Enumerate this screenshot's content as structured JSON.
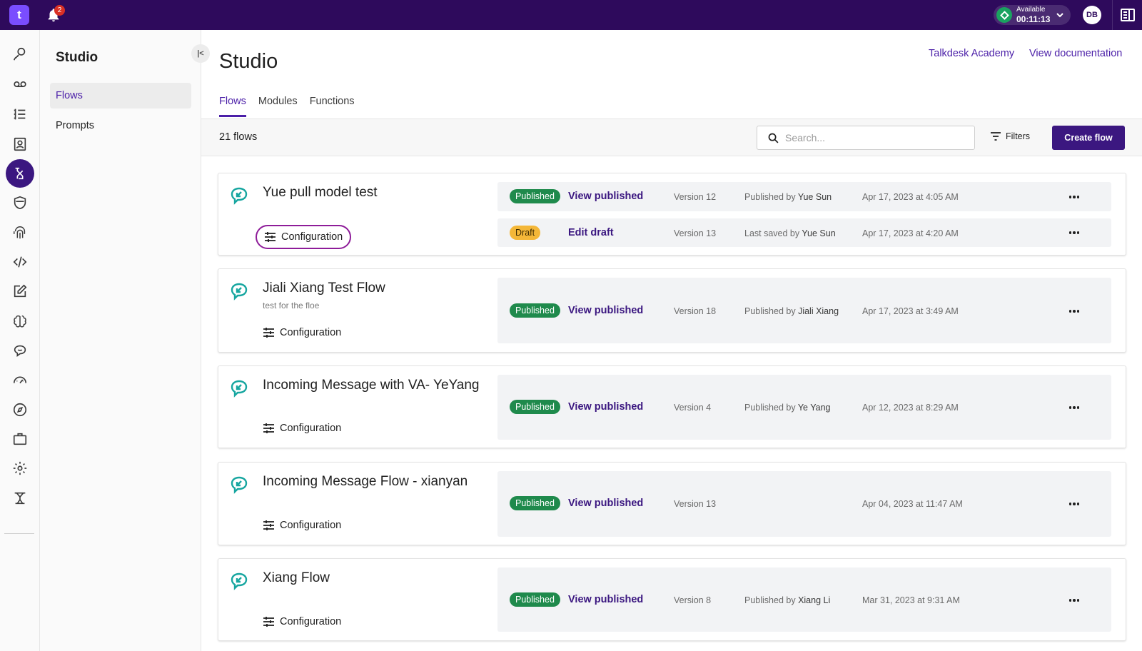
{
  "app": {
    "logo_text": "t",
    "notification_count": "2",
    "status_label": "Available",
    "status_timer": "00:11:13",
    "avatar_initials": "DB",
    "accent_color": "#2e0a5c"
  },
  "sidebar": {
    "title": "Studio",
    "items": [
      {
        "label": "Flows",
        "active": true
      },
      {
        "label": "Prompts",
        "active": false
      }
    ]
  },
  "header": {
    "title": "Studio",
    "links": [
      "Talkdesk Academy",
      "View documentation"
    ],
    "tabs": [
      "Flows",
      "Modules",
      "Functions"
    ]
  },
  "toolbar": {
    "flow_count": "21 flows",
    "search_placeholder": "Search...",
    "filters_label": "Filters",
    "create_label": "Create flow"
  },
  "flows": [
    {
      "name": "Yue pull model test",
      "description": "",
      "config_label": "Configuration",
      "versions": [
        {
          "status": "Published",
          "action": "View published",
          "version": "Version 12",
          "by_label": "Published by",
          "by_name": "Yue Sun",
          "date": "Apr 17, 2023 at 4:05 AM"
        },
        {
          "status": "Draft",
          "action": "Edit draft",
          "version": "Version 13",
          "by_label": "Last saved by",
          "by_name": "Yue Sun",
          "date": "Apr 17, 2023 at 4:20 AM"
        }
      ]
    },
    {
      "name": "Jiali Xiang Test Flow",
      "description": "test for the floe",
      "config_label": "Configuration",
      "versions": [
        {
          "status": "Published",
          "action": "View published",
          "version": "Version 18",
          "by_label": "Published by",
          "by_name": "Jiali Xiang",
          "date": "Apr 17, 2023 at 3:49 AM"
        }
      ]
    },
    {
      "name": "Incoming Message with VA- YeYang",
      "description": "",
      "config_label": "Configuration",
      "versions": [
        {
          "status": "Published",
          "action": "View published",
          "version": "Version 4",
          "by_label": "Published by",
          "by_name": "Ye Yang",
          "date": "Apr 12, 2023 at 8:29 AM"
        }
      ]
    },
    {
      "name": "Incoming Message Flow - xianyan",
      "description": "",
      "config_label": "Configuration",
      "versions": [
        {
          "status": "Published",
          "action": "View published",
          "version": "Version 13",
          "by_label": "",
          "by_name": "",
          "date": "Apr 04, 2023 at 11:47 AM"
        }
      ]
    },
    {
      "name": "Xiang Flow",
      "description": "",
      "config_label": "Configuration",
      "versions": [
        {
          "status": "Published",
          "action": "View published",
          "version": "Version 8",
          "by_label": "Published by",
          "by_name": "Xiang Li",
          "date": "Mar 31, 2023 at 9:31 AM"
        }
      ]
    }
  ]
}
